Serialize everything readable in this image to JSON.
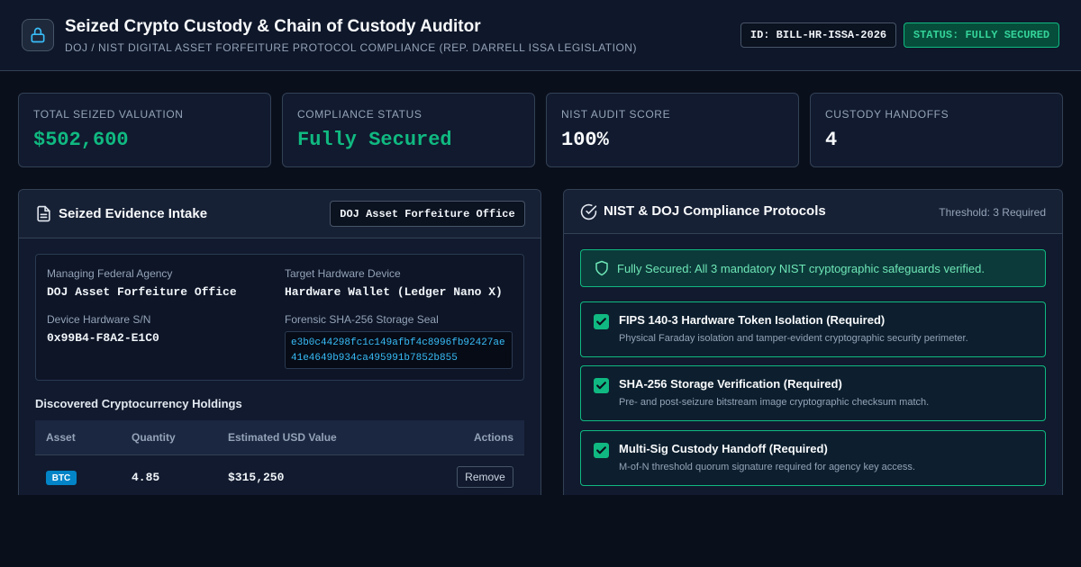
{
  "header": {
    "title": "Seized Crypto Custody & Chain of Custody Auditor",
    "subtitle": "DOJ / NIST DIGITAL ASSET FORFEITURE PROTOCOL COMPLIANCE (REP. DARRELL ISSA LEGISLATION)",
    "logo_icon": "lock-icon",
    "id_badge": "ID: BILL-HR-ISSA-2026",
    "status_badge": "STATUS: FULLY SECURED"
  },
  "stats": [
    {
      "label": "TOTAL SEIZED VALUATION",
      "value": "$502,600",
      "color": "#10b981"
    },
    {
      "label": "COMPLIANCE STATUS",
      "value": "Fully Secured",
      "color": "#10b981"
    },
    {
      "label": "NIST AUDIT SCORE",
      "value": "100%",
      "color": "#f8fafc"
    },
    {
      "label": "CUSTODY HANDOFFS",
      "value": "4",
      "color": "#f8fafc"
    }
  ],
  "evidence": {
    "title": "Seized Evidence Intake",
    "icon": "document-icon",
    "office_badge": "DOJ Asset Forfeiture Office",
    "fields": {
      "agency_label": "Managing Federal Agency",
      "agency_value": "DOJ Asset Forfeiture Office",
      "device_label": "Target Hardware Device",
      "device_value": "Hardware Wallet (Ledger Nano X)",
      "serial_label": "Device Hardware S/N",
      "serial_value": "0x99B4-F8A2-E1C0",
      "seal_label": "Forensic SHA-256 Storage Seal",
      "seal_value": "e3b0c44298fc1c149afbf4c8996fb92427ae41e4649b934ca495991b7852b855"
    },
    "holdings_title": "Discovered Cryptocurrency Holdings",
    "columns": [
      "Asset",
      "Quantity",
      "Estimated USD Value",
      "Actions"
    ],
    "rows": [
      {
        "asset": "BTC",
        "quantity": "4.85",
        "value": "$315,250",
        "action": "Remove"
      }
    ]
  },
  "compliance": {
    "title": "NIST & DOJ Compliance Protocols",
    "icon": "check-circle-icon",
    "threshold": "Threshold: 3 Required",
    "alert_icon": "shield-icon",
    "alert": "Fully Secured: All 3 mandatory NIST cryptographic safeguards verified.",
    "items": [
      {
        "title": "FIPS 140-3 Hardware Token Isolation (Required)",
        "desc": "Physical Faraday isolation and tamper-evident cryptographic security perimeter.",
        "checked": true
      },
      {
        "title": "SHA-256 Storage Verification (Required)",
        "desc": "Pre- and post-seizure bitstream image cryptographic checksum match.",
        "checked": true
      },
      {
        "title": "Multi-Sig Custody Handoff (Required)",
        "desc": "M-of-N threshold quorum signature required for agency key access.",
        "checked": true
      }
    ]
  },
  "colors": {
    "accent": "#10b981",
    "btc_badge": "#0284c7",
    "hash_text": "#38bdf8"
  }
}
